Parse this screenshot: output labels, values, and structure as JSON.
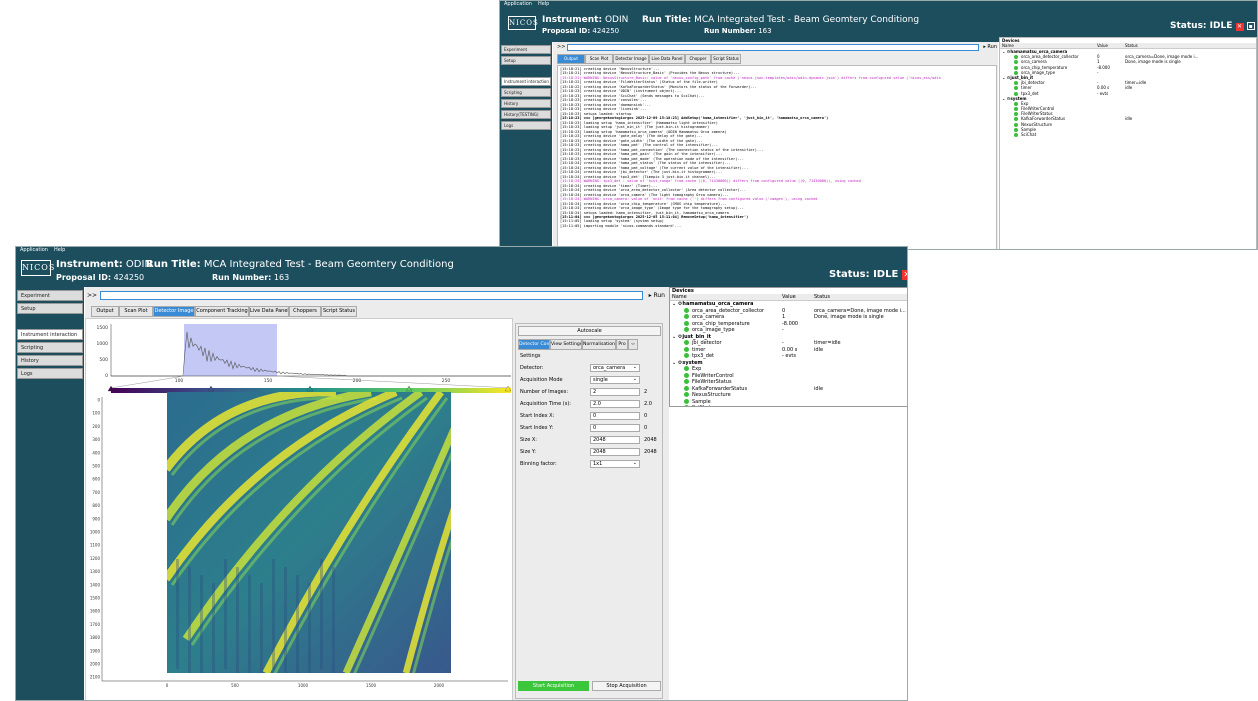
{
  "app": {
    "menu": [
      "Application",
      "Help"
    ],
    "logo": "NICOS"
  },
  "header": {
    "instrument_label": "Instrument:",
    "instrument": "ODIN",
    "proposal_label": "Proposal ID:",
    "proposal": "424250",
    "run_title_label": "Run Title:",
    "run_title": "MCA Integrated Test - Beam Geomtery Conditiong",
    "run_number_label": "Run Number:",
    "run_number": "163",
    "status_label": "Status:",
    "status": "IDLE"
  },
  "sidebar": {
    "top": [
      "Experiment",
      "Setup"
    ],
    "items": [
      "Instrument interaction",
      "Scripting",
      "History",
      "Logs"
    ]
  },
  "bg_sidebar": {
    "items": [
      "Instrument interaction",
      "Scripting",
      "History",
      "History(TESTING)",
      "Logs"
    ]
  },
  "command": {
    "prompt": ">>",
    "run": "▸ Run"
  },
  "tabs": [
    "Output",
    "Scan Plot",
    "Detector Image",
    "Component Tracking",
    "Live Data Panel",
    "Choppers",
    "Script Status"
  ],
  "bg_tabs": [
    "Output",
    "Scan Plot",
    "Detector Image",
    "Live Data Panel",
    "Chopper",
    "Script Status"
  ],
  "console": [
    {
      "t": "[15:18:21]  creating device 'NexusStructure'...",
      "c": ""
    },
    {
      "t": "[15:18:21]  creating device 'NexusStructure_Basic' (Provides the Nexus structure)...",
      "c": ""
    },
    {
      "t": "[15:18:21]  WARNING: NexusStructure_Basic: value of 'nexus_config_path' from cache ('nexus-json-templates/odin/odin-dynamic.json') differs from configured value ('nicos_ess/odin",
      "c": "w"
    },
    {
      "t": "[15:18:22]  creating device 'FileWriterStatus' (Status of the file-writer)",
      "c": ""
    },
    {
      "t": "[15:18:22]  creating device 'KafkaForwarderStatus' (Monitors the status of the Forwarder)...",
      "c": ""
    },
    {
      "t": "[15:18:23]  creating device 'ODIN' (instrument object)...",
      "c": ""
    },
    {
      "t": "[15:18:23]  creating device 'SciChat' (Sends messages to SciChat)...",
      "c": ""
    },
    {
      "t": "[15:18:23]  creating device 'consoles'...",
      "c": ""
    },
    {
      "t": "[15:18:23]  creating device 'daemonsink'...",
      "c": ""
    },
    {
      "t": "[15:18:23]  creating device 'livesink'...",
      "c": ""
    },
    {
      "t": "[15:18:23]  setups loaded: startup",
      "c": ""
    },
    {
      "t": "[15:18:23]  === [georgekontogiorgos 2025-12-09 15:18:23]  AddSetup('hama_intensifier', 'just_bin_it', 'hamamatsu_orca_camera')",
      "c": "s"
    },
    {
      "t": "[15:18:23]  loading setup 'hama_intensifier' (Hamamatsu light intensifier)",
      "c": ""
    },
    {
      "t": "[15:18:23]  loading setup 'just_bin_it' (The just-bin-it histogrammer)",
      "c": ""
    },
    {
      "t": "[15:18:23]  loading setup 'hamamatsu_orca_camera' (ODIN Hamamatsu Orca camera)",
      "c": ""
    },
    {
      "t": "[15:18:23]  creating device 'gate_delay' (The delay of the gate)...",
      "c": ""
    },
    {
      "t": "[15:18:23]  creating device 'gate_width' (The width of the gate)...",
      "c": ""
    },
    {
      "t": "[15:18:23]  creating device 'hama_pmt' (The control of the intensifier)...",
      "c": ""
    },
    {
      "t": "[15:18:23]  creating device 'hama_pmt_connection' (The connection status of the intensifier)...",
      "c": ""
    },
    {
      "t": "[15:18:23]  creating device 'hama_pmt_gain' (The gain of the intensifier)...",
      "c": ""
    },
    {
      "t": "[15:18:23]  creating device 'hama_pmt_mode' (The operation mode of the intensifier)...",
      "c": ""
    },
    {
      "t": "[15:18:24]  creating device 'hama_pmt_status' (The status of the intensifier)...",
      "c": ""
    },
    {
      "t": "[15:18:24]  creating device 'hama_pmt_voltage' (The current value of the intensifier)...",
      "c": ""
    },
    {
      "t": "[15:18:24]  creating device 'jbi_detector' (The just-bin-it histogrammer)...",
      "c": ""
    },
    {
      "t": "[15:18:24]  creating device 'tpx3_det' (Timepix 3 just-bin-it channel)...",
      "c": ""
    },
    {
      "t": "[15:18:24]  WARNING: tpx3_det : value of 'hist_range' from cache ((0, 71430000)) differs from configured value ((0, 71430000)), using cached",
      "c": "w"
    },
    {
      "t": "[15:18:24]  creating device 'timer' (Timer)...",
      "c": ""
    },
    {
      "t": "[15:18:24]  creating device 'orca_area_detector_collector' (Area detector collector)...",
      "c": ""
    },
    {
      "t": "[15:18:24]  creating device 'orca_camera' (The light tomography Orca camera)...",
      "c": ""
    },
    {
      "t": "[15:18:24]  WARNING: orca_camera: value of 'unit' from cache ('') differs from configured value ('images'), using cached",
      "c": "w"
    },
    {
      "t": "[15:18:24]  creating device 'orca_chip_temperature' (CMOS chip temperature)...",
      "c": ""
    },
    {
      "t": "[15:18:24]  creating device 'orca_image_type' (Image type for the tomography setup)...",
      "c": ""
    },
    {
      "t": "[15:18:24]  setups loaded: hama_intensifier, just_bin_it, hamamatsu_orca_camera",
      "c": ""
    },
    {
      "t": "[15:11:04]  === [georgekontogiorgos 2025-12-05 15:11:04]  RemoveSetup('hama_intensifier')",
      "c": "s"
    },
    {
      "t": "[15:11:05]  loading setup 'system' (system setup)",
      "c": ""
    },
    {
      "t": "[15:11:05]  importing module 'nicos.commands.standard'...",
      "c": ""
    }
  ],
  "devices": {
    "title": "Devices",
    "headers": [
      "Name",
      "Value",
      "Status"
    ],
    "groups": [
      {
        "name": "hamamatsu_orca_camera",
        "items": [
          {
            "name": "orca_area_detector_collector",
            "value": "0",
            "status": "orca_camera=Done, image mode i..."
          },
          {
            "name": "orca_camera",
            "value": "1",
            "status": "Done, image mode is single"
          },
          {
            "name": "orca_chip_temperature",
            "value": "-8.000",
            "status": ""
          },
          {
            "name": "orca_image_type",
            "value": "-",
            "status": ""
          }
        ]
      },
      {
        "name": "just_bin_it",
        "items": [
          {
            "name": "jbi_detector",
            "value": "-",
            "status": "timer=idle"
          },
          {
            "name": "timer",
            "value": "0.00 s",
            "status": "idle"
          },
          {
            "name": "tpx3_det",
            "value": "- evts",
            "status": ""
          }
        ]
      },
      {
        "name": "system",
        "items": [
          {
            "name": "Exp",
            "value": "",
            "status": ""
          },
          {
            "name": "FileWriterControl",
            "value": "",
            "status": ""
          },
          {
            "name": "FileWriterStatus",
            "value": "",
            "status": ""
          },
          {
            "name": "KafkaForwarderStatus",
            "value": "",
            "status": "idle"
          },
          {
            "name": "NexusStructure",
            "value": "",
            "status": ""
          },
          {
            "name": "Sample",
            "value": "",
            "status": ""
          },
          {
            "name": "SciChat",
            "value": "",
            "status": ""
          }
        ]
      }
    ],
    "overflow_text": "m configured value ('nicos_ess/odi"
  },
  "detector": {
    "autoscale": "Autoscale",
    "subtabs": [
      "Detector Control",
      "View Settings",
      "Normalisation",
      "Pro"
    ],
    "settings_title": "Settings",
    "fields": [
      {
        "label": "Detector:",
        "value": "orca_camera",
        "type": "select",
        "readback": ""
      },
      {
        "label": "Acquisition Mode",
        "value": "single",
        "type": "select",
        "readback": ""
      },
      {
        "label": "Number of Images:",
        "value": "2",
        "type": "input",
        "readback": "2"
      },
      {
        "label": "Acquisition Time (s):",
        "value": "2.0",
        "type": "input",
        "readback": "2.0"
      },
      {
        "label": "Start Index X:",
        "value": "0",
        "type": "input",
        "readback": "0"
      },
      {
        "label": "Start Index Y:",
        "value": "0",
        "type": "input",
        "readback": "0"
      },
      {
        "label": "Size X:",
        "value": "2048",
        "type": "input",
        "readback": "2048"
      },
      {
        "label": "Size Y:",
        "value": "2048",
        "type": "input",
        "readback": "2048"
      },
      {
        "label": "Binning factor:",
        "value": "1x1",
        "type": "select",
        "readback": ""
      }
    ],
    "start": "Start Acquisition",
    "stop": "Stop Acquisition",
    "hist_y_ticks": [
      "1500",
      "1000",
      "500",
      "0"
    ],
    "hist_x_ticks": [
      "100",
      "150",
      "200",
      "250"
    ],
    "img_y_ticks": [
      "0",
      "100",
      "200",
      "300",
      "400",
      "500",
      "600",
      "700",
      "800",
      "900",
      "1000",
      "1100",
      "1200",
      "1300",
      "1400",
      "1500",
      "1600",
      "1700",
      "1800",
      "1900",
      "2000",
      "2100"
    ],
    "img_x_ticks": [
      "0",
      "500",
      "1000",
      "1500",
      "2000"
    ],
    "colors": {
      "accent": "#3a8bd6",
      "header": "#1d4e5e",
      "start": "#3cc63c",
      "warning": "#c020c0",
      "ok": "#3bbf3b"
    }
  }
}
